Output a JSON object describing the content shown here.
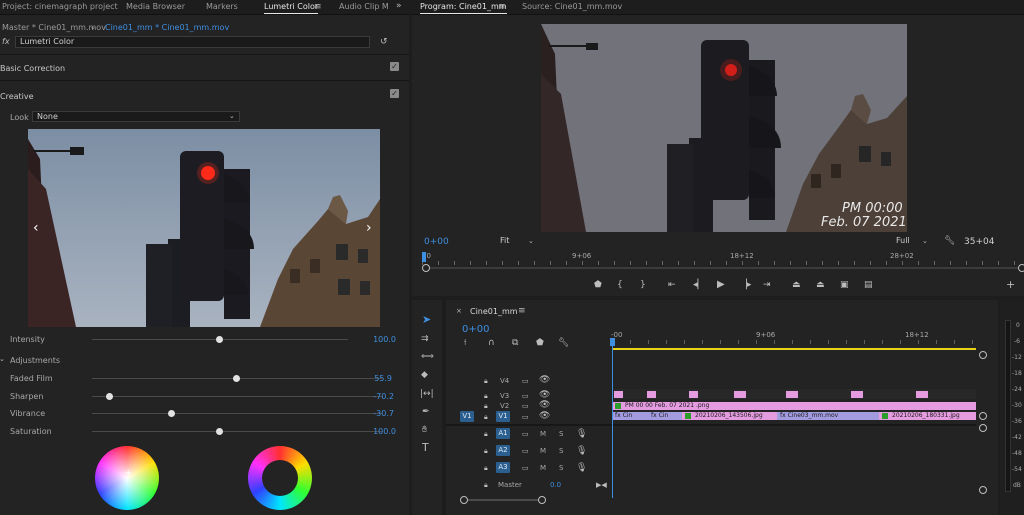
{
  "left_panel": {
    "tabs": [
      "Project: cinemagraph project",
      "Media Browser",
      "Markers",
      "Lumetri Color",
      "Audio Clip M"
    ],
    "active_tab": "Lumetri Color",
    "source_clip": "Master * Cine01_mm.mov",
    "sequence_clip": "Cine01_mm * Cine01_mm.mov",
    "fx_label": "fx",
    "effect_name": "Lumetri Color",
    "basic_correction": "Basic Correction",
    "creative": "Creative",
    "look_label": "Look",
    "look_value": "None",
    "intensity": {
      "label": "Intensity",
      "value": "100.0",
      "level": 1.0
    },
    "adjustments": "Adjustments",
    "sliders": [
      {
        "label": "Faded Film",
        "value": "55.9",
        "level": 0.559
      },
      {
        "label": "Sharpen",
        "value": "-70.2",
        "level": 0.149
      },
      {
        "label": "Vibrance",
        "value": "-30.7",
        "level": 0.3465
      },
      {
        "label": "Saturation",
        "value": "100.0",
        "level": 0.5
      }
    ]
  },
  "program_monitor": {
    "tabs": [
      "Program: Cine01_mm",
      "Source: Cine01_mm.mov"
    ],
    "overlay_time": "PM 00:00",
    "overlay_date": "Feb. 07 2021",
    "timecode": "0+00",
    "fit": "Fit",
    "quality": "Full",
    "duration": "35+04",
    "ruler": [
      "00",
      "9+06",
      "18+12",
      "28+02"
    ]
  },
  "timeline": {
    "sequence_name": "Cine01_mm",
    "timecode": "0+00",
    "ruler": [
      "-00",
      "9+06",
      "18+12"
    ],
    "video_tracks": [
      "V4",
      "V3",
      "V2",
      "V1"
    ],
    "audio_tracks": [
      "A1",
      "A2",
      "A3"
    ],
    "source_v1": "V1",
    "master_label": "Master",
    "master_value": "0.0",
    "clips": {
      "title": "PM 00  00 Feb. 07 2021 .png",
      "c1": "Cin",
      "c2": "Cin",
      "c3": "20210206_143506.jpg",
      "c4": "Cine03_mm.mov",
      "c5": "20210206_180331.jpg"
    },
    "meter_labels": [
      "0",
      "-6",
      "-12",
      "-18",
      "-24",
      "-30",
      "-36",
      "-42",
      "-48",
      "-54",
      "dB"
    ]
  },
  "colors": {
    "accent": "#3f8fe0",
    "clip_pink": "#e59be0",
    "clip_purple": "#a39be0",
    "playhead": "#3f8fe0",
    "work_area": "#e8d417"
  }
}
